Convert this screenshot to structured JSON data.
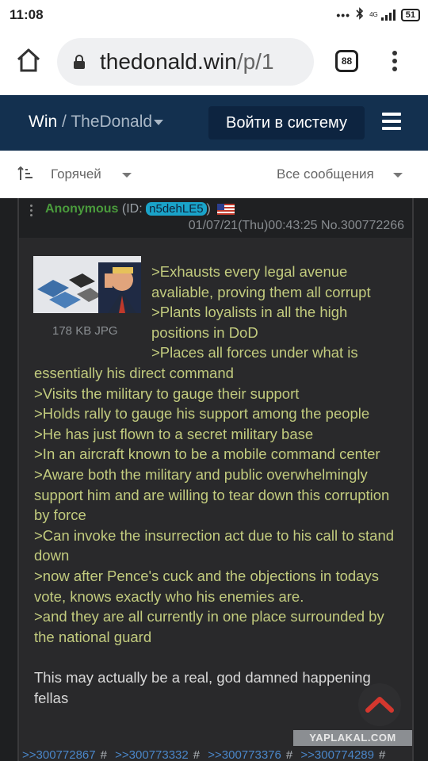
{
  "status_bar": {
    "time": "11:08",
    "network": "4G",
    "battery": "51",
    "icons": [
      "dots-icon",
      "bluetooth-icon",
      "signal-icon",
      "battery-icon"
    ]
  },
  "browser": {
    "url_host": "thedonald.win",
    "url_path": "/p/1",
    "tab_count": "88",
    "icons": [
      "home-icon",
      "lock-icon",
      "tabs-icon",
      "kebab-menu-icon"
    ]
  },
  "site_header": {
    "site": "Win",
    "separator": "/",
    "community": "TheDonald",
    "login_label": "Войти в систему",
    "colors": {
      "header_bg": "#13304f",
      "button_bg": "#0d2440"
    }
  },
  "sort_bar": {
    "sort_label": "Горячей",
    "filter_label": "Все сообщения"
  },
  "post": {
    "author": "Anonymous",
    "id_prefix": "(ID:",
    "id": "n5dehLE5",
    "id_suffix": ")",
    "flag": "us-flag-icon",
    "timestamp": "01/07/21(Thu)00:43:25 No.300772266",
    "attachment_size": "178 KB JPG",
    "greentext_indented": [
      ">Exhausts every legal avenue avaliable, proving them all corrupt",
      ">Plants loyalists in all the high positions in DoD"
    ],
    "greentext_partial": ">Places all forces under what is essentially his direct command",
    "greentext": [
      ">Visits the military to gauge their support",
      ">Holds rally to gauge his support among the people",
      ">He has just flown to a secret military base",
      ">In an aircraft known to be a mobile command center",
      ">Aware both the military and public overwhelmingly support him and are willing to tear down this corruption by force",
      ">Can invoke the insurrection act due to his call to stand down",
      ">now after Pence's cuck and the objections in todays vote, knows exactly who his enemies are.",
      ">and they are all currently in one place surrounded by the national guard"
    ],
    "closing": "This may actually be a real, god damned happening fellas",
    "backlinks": [
      ">>300772867",
      ">>300773332",
      ">>300773376",
      ">>300774289"
    ],
    "backlink_hash": "#",
    "colors": {
      "greentext": "#c2cb7e",
      "author": "#4a9b3c",
      "id_badge": "#1aa3c9"
    }
  },
  "watermark": "YAPLAKAL.COM"
}
